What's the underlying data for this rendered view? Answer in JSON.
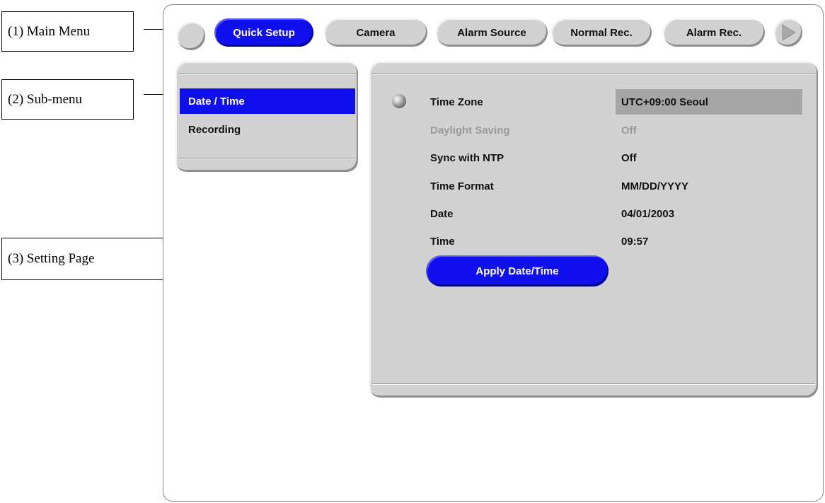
{
  "callouts": {
    "main_menu": "(1) Main Menu",
    "sub_menu": "(2) Sub-menu",
    "setting_page": "(3) Setting Page"
  },
  "main_menu": {
    "prev_icon": "circle-button-icon",
    "tabs": [
      {
        "label": "Quick Setup",
        "active": true
      },
      {
        "label": "Camera",
        "active": false
      },
      {
        "label": "Alarm Source",
        "active": false
      },
      {
        "label": "Normal Rec.",
        "active": false
      },
      {
        "label": "Alarm Rec.",
        "active": false
      }
    ],
    "next_icon": "play-arrow-icon"
  },
  "sub_menu": {
    "items": [
      {
        "label": "Date / Time",
        "selected": true
      },
      {
        "label": "Recording",
        "selected": false
      }
    ]
  },
  "settings": {
    "rows": [
      {
        "label": "Time Zone",
        "value": "UTC+09:00 Seoul",
        "highlighted": true,
        "disabled": false
      },
      {
        "label": "Daylight Saving",
        "value": "Off",
        "highlighted": false,
        "disabled": true
      },
      {
        "label": "Sync with NTP",
        "value": "Off",
        "highlighted": false,
        "disabled": false
      },
      {
        "label": "Time Format",
        "value": "MM/DD/YYYY",
        "highlighted": false,
        "disabled": false
      },
      {
        "label": "Date",
        "value": "04/01/2003",
        "highlighted": false,
        "disabled": false
      },
      {
        "label": "Time",
        "value": "09:57",
        "highlighted": false,
        "disabled": false
      }
    ],
    "apply_label": "Apply Date/Time"
  },
  "colors": {
    "accent_blue": "#1010ee",
    "panel_gray": "#d2d2d2",
    "highlight_gray": "#a6a6a6",
    "disabled_text": "#9a9a9a"
  }
}
